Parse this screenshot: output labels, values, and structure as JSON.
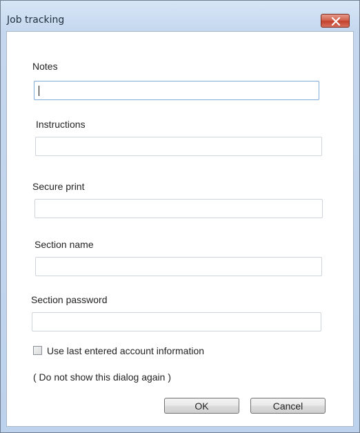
{
  "window": {
    "title": "Job tracking",
    "close_icon": "close-icon"
  },
  "form": {
    "notes": {
      "label": "Notes",
      "value": ""
    },
    "instructions": {
      "label": "Instructions",
      "value": ""
    },
    "secure_print": {
      "label": "Secure print",
      "value": ""
    },
    "section_name": {
      "label": "Section name",
      "value": ""
    },
    "section_password": {
      "label": "Section password",
      "value": ""
    },
    "use_last_checkbox": {
      "label": "Use last entered account information",
      "checked": false
    },
    "do_not_show_text": "( Do not show this dialog again )"
  },
  "buttons": {
    "ok": "OK",
    "cancel": "Cancel"
  },
  "colors": {
    "close_button": "#c94f3a",
    "focus_border": "#7fa9d6"
  }
}
